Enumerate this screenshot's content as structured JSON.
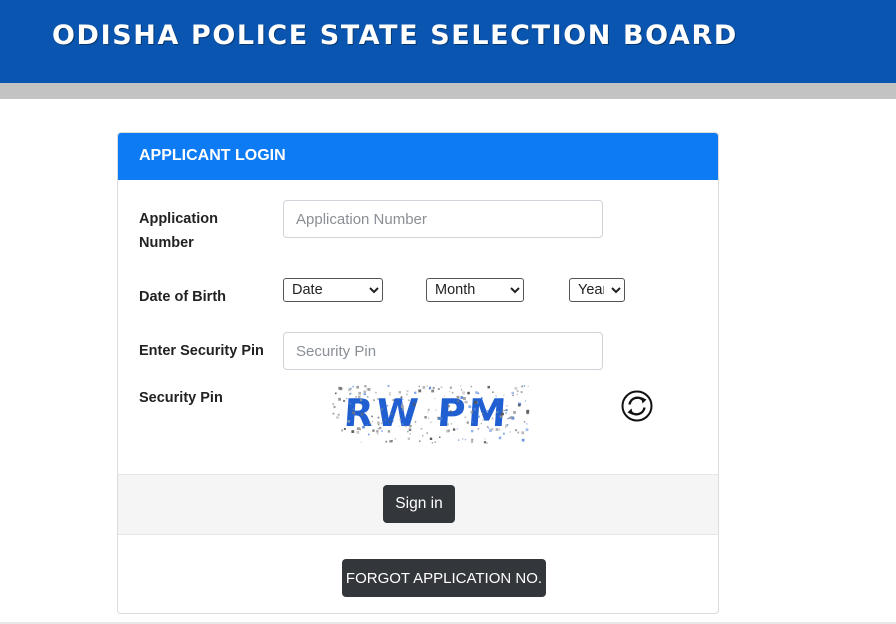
{
  "header": {
    "title": "ODISHA POLICE STATE SELECTION BOARD"
  },
  "login_card": {
    "title": "APPLICANT LOGIN",
    "application_number": {
      "label": "Application Number",
      "placeholder": "Application Number",
      "value": ""
    },
    "date_of_birth": {
      "label": "Date of Birth",
      "date_selected": "Date",
      "month_selected": "Month",
      "year_selected": "Year"
    },
    "security_pin_input": {
      "label": "Enter Security Pin",
      "placeholder": "Security Pin",
      "value": ""
    },
    "captcha": {
      "label": "Security Pin",
      "text": "RW PM",
      "refresh_icon": "refresh-icon"
    },
    "sign_in_label": "Sign in",
    "forgot_label": "FORGOT APPLICATION NO."
  },
  "colors": {
    "banner": "#0a55b0",
    "card_header": "#0d7bf4",
    "button": "#33373c",
    "captcha_text": "#1f5fd1"
  }
}
